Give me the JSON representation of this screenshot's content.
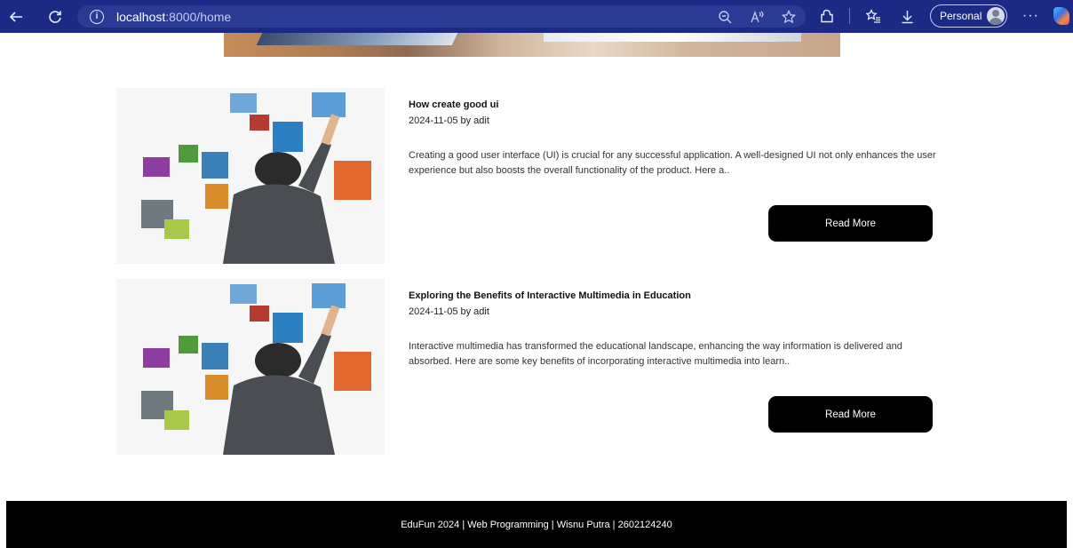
{
  "browser": {
    "url_host": "localhost",
    "url_path": ":8000/home",
    "profile_label": "Personal",
    "more_label": "···",
    "info_glyph": "i",
    "icons": [
      "back-arrow-icon",
      "reload-icon",
      "info-icon",
      "zoom-icon",
      "read-aloud-icon",
      "favorite-star-icon",
      "extensions-icon",
      "favorites-list-icon",
      "download-icon",
      "avatar",
      "more-icon",
      "copilot-icon"
    ]
  },
  "articles": [
    {
      "title": "How create good ui",
      "meta": "2024-11-05 by adit",
      "excerpt": "Creating a good user interface (UI) is crucial for any successful application. A well-designed UI not only enhances the user experience but also boosts the overall functionality of the product. Here a..",
      "button_label": "Read More"
    },
    {
      "title": "Exploring the Benefits of Interactive Multimedia in Education",
      "meta": "2024-11-05 by adit",
      "excerpt": "Interactive multimedia has transformed the educational landscape, enhancing the way information is delivered and absorbed. Here are some key benefits of incorporating interactive multimedia into learn..",
      "button_label": "Read More"
    }
  ],
  "footer": {
    "text": "EduFun 2024 | Web Programming | Wisnu Putra | 2602124240"
  },
  "colors": {
    "browser_bar": "#1c2a86",
    "button_bg": "#000000",
    "footer_bg": "#000000"
  }
}
